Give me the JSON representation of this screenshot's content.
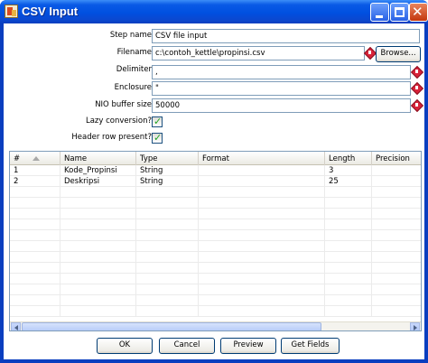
{
  "window": {
    "title": "CSV Input"
  },
  "form": {
    "step_name": {
      "label": "Step name",
      "value": "CSV file input"
    },
    "filename": {
      "label": "Filename",
      "value": "c:\\contoh_kettle\\propinsi.csv",
      "browse": "Browse..."
    },
    "delimiter": {
      "label": "Delimiter",
      "value": ","
    },
    "enclosure": {
      "label": "Enclosure",
      "value": "\""
    },
    "nio_buffer": {
      "label": "NIO buffer size",
      "value": "50000"
    },
    "lazy_conversion": {
      "label": "Lazy conversion?",
      "checked": true
    },
    "header_row": {
      "label": "Header row present?",
      "checked": true
    }
  },
  "table": {
    "columns": [
      "#",
      "Name",
      "Type",
      "Format",
      "Length",
      "Precision"
    ],
    "rows": [
      {
        "num": "1",
        "name": "Kode_Propinsi",
        "type": "String",
        "format": "",
        "length": "3",
        "precision": ""
      },
      {
        "num": "2",
        "name": "Deskripsi",
        "type": "String",
        "format": "",
        "length": "25",
        "precision": ""
      }
    ]
  },
  "buttons": {
    "ok": "OK",
    "cancel": "Cancel",
    "preview": "Preview",
    "get_fields": "Get Fields"
  },
  "colors": {
    "title_bar": "#0a5ae6",
    "check": "#21a121",
    "variable_icon": "#d8233a"
  }
}
